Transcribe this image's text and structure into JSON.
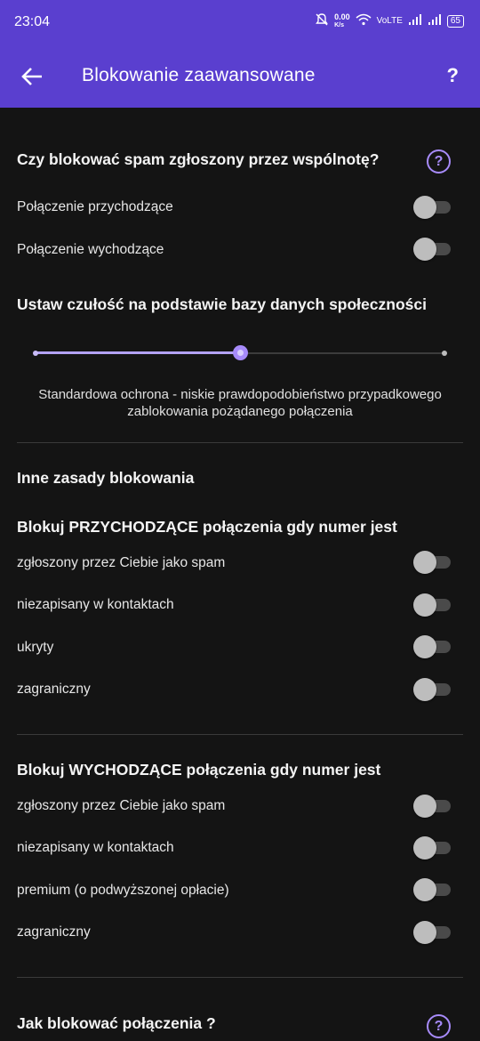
{
  "status_bar": {
    "time": "23:04",
    "speed": "0.00",
    "speed_unit": "K/s",
    "network": "VoLTE",
    "battery": "65"
  },
  "app_bar": {
    "title": "Blokowanie zaawansowane",
    "help": "?"
  },
  "community": {
    "title": "Czy blokować spam zgłoszony przez wspólnotę?",
    "help": "?",
    "rows": [
      {
        "label": "Połączenie przychodzące",
        "on": false
      },
      {
        "label": "Połączenie wychodzące",
        "on": false
      }
    ]
  },
  "sensitivity": {
    "title": "Ustaw czułość na podstawie bazy danych społeczności",
    "level": 0.5,
    "description": "Standardowa ochrona - niskie prawdopodobieństwo przypadkowego zablokowania pożądanego połączenia"
  },
  "other_rules": {
    "title": "Inne zasady blokowania"
  },
  "incoming": {
    "title": "Blokuj PRZYCHODZĄCE połączenia gdy numer jest",
    "rows": [
      {
        "label": "zgłoszony przez Ciebie jako spam",
        "on": false
      },
      {
        "label": "niezapisany w kontaktach",
        "on": false
      },
      {
        "label": "ukryty",
        "on": false
      },
      {
        "label": "zagraniczny",
        "on": false
      }
    ]
  },
  "outgoing": {
    "title": "Blokuj WYCHODZĄCE połączenia gdy numer jest",
    "rows": [
      {
        "label": "zgłoszony przez Ciebie jako spam",
        "on": false
      },
      {
        "label": "niezapisany w kontaktach",
        "on": false
      },
      {
        "label": "premium (o podwyższonej opłacie)",
        "on": false
      },
      {
        "label": "zagraniczny",
        "on": false
      }
    ]
  },
  "how_to_block": {
    "title": "Jak blokować połączenia ?",
    "help": "?"
  },
  "colors": {
    "app_bar": "#5a3fcf",
    "accent": "#a78bfa",
    "background": "#141414"
  }
}
